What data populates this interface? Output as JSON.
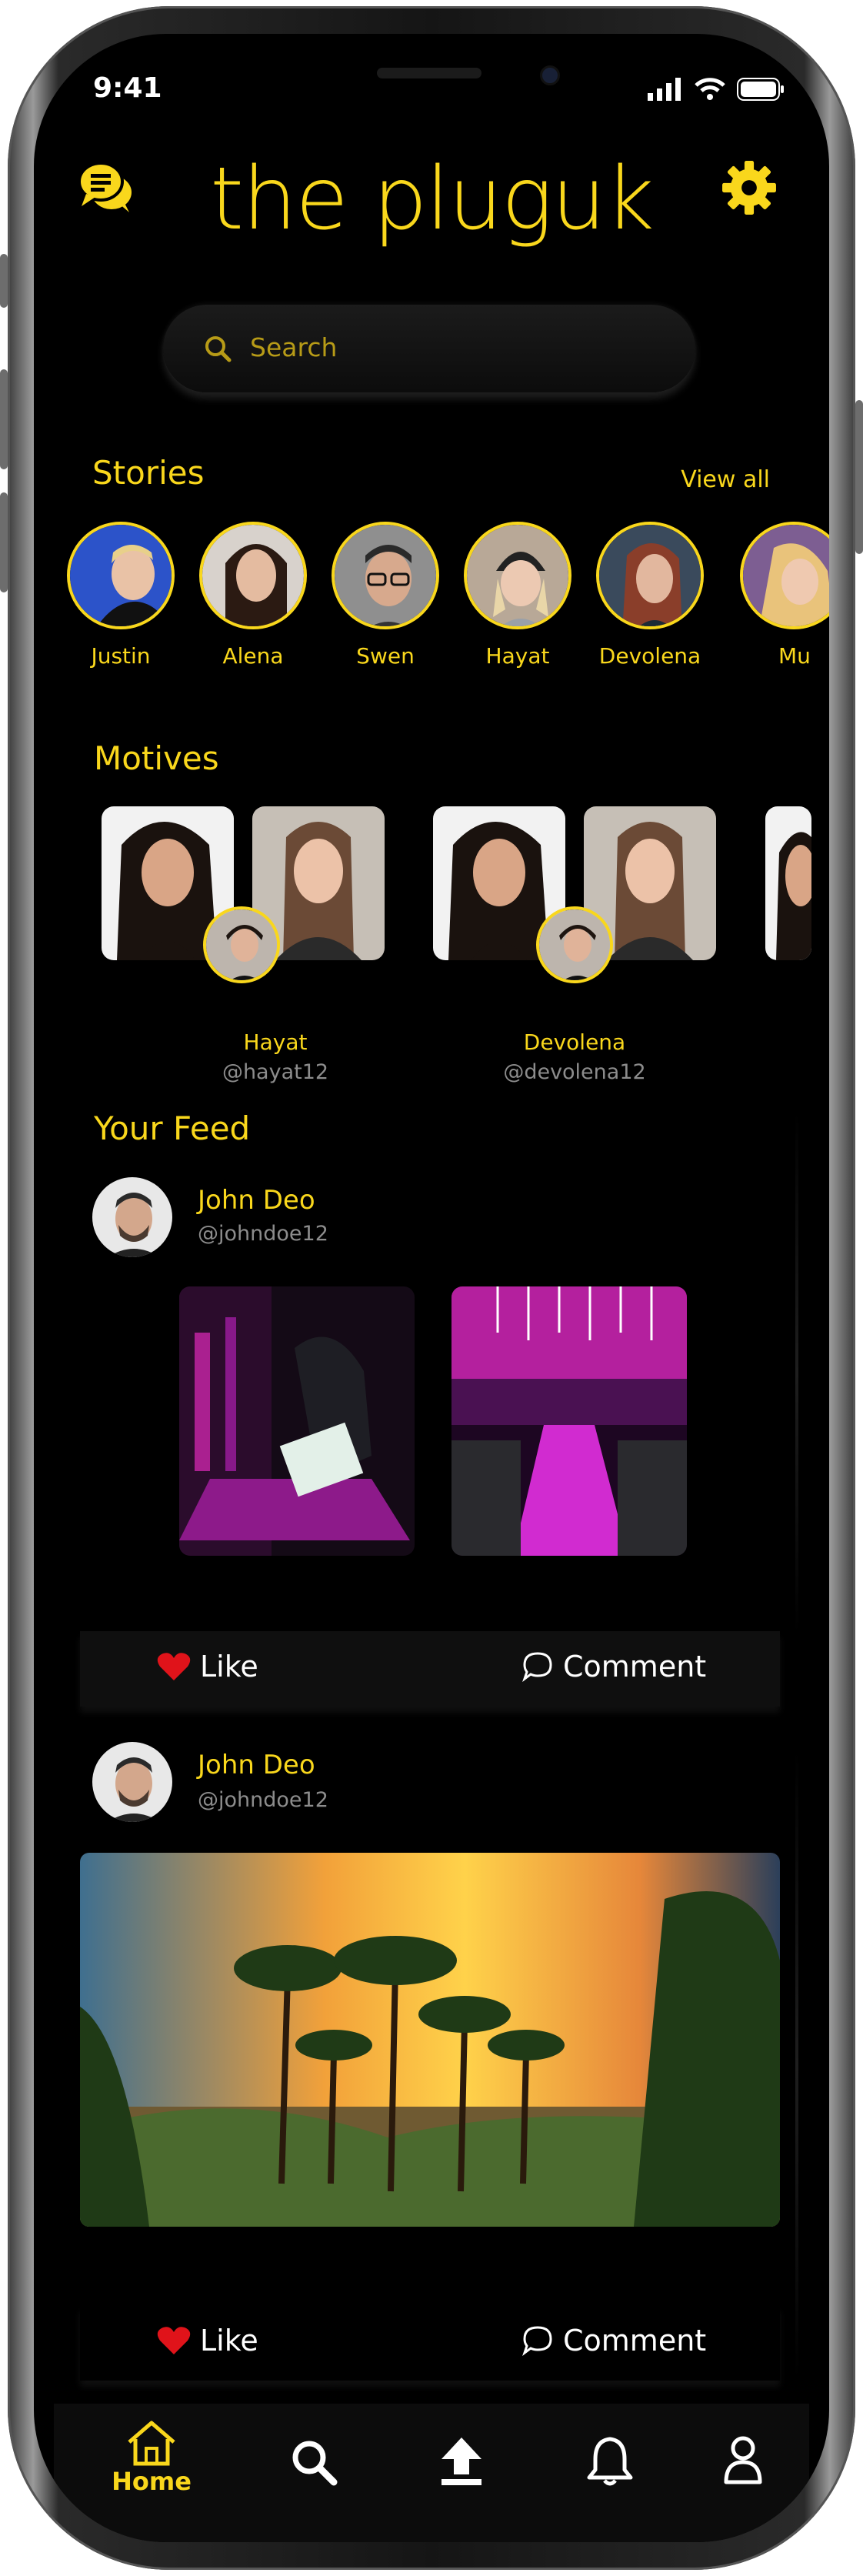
{
  "status_bar": {
    "time": "9:41"
  },
  "header": {
    "logo": "the pluguk",
    "chat_icon": "chat-bubbles-icon",
    "settings_icon": "gear-icon"
  },
  "search": {
    "placeholder": "Search"
  },
  "stories": {
    "title": "Stories",
    "view_all": "View all",
    "items": [
      {
        "name": "Justin",
        "color": "#2c53c9"
      },
      {
        "name": "Alena",
        "color": "#c9c3bd"
      },
      {
        "name": "Swen",
        "color": "#8f8f8f"
      },
      {
        "name": "Hayat",
        "color": "#b8a897"
      },
      {
        "name": "Devolena",
        "color": "#3a4a5c"
      },
      {
        "name": "Mu",
        "color": "#7d5e92"
      }
    ]
  },
  "motives": {
    "title": "Motives",
    "items": [
      {
        "name": "Hayat",
        "handle": "@hayat12"
      },
      {
        "name": "Devolena",
        "handle": "@devolena12"
      }
    ]
  },
  "feed": {
    "title": "Your Feed",
    "posts": [
      {
        "user": "John Deo",
        "handle": "@johndoe12",
        "like": "Like",
        "comment": "Comment"
      },
      {
        "user": "John Deo",
        "handle": "@johndoe12",
        "like": "Like",
        "comment": "Comment"
      }
    ]
  },
  "nav": {
    "home": "Home",
    "items": [
      "home-icon",
      "search-icon",
      "upload-icon",
      "bell-icon",
      "profile-icon"
    ]
  },
  "colors": {
    "accent": "#f9d71c",
    "background": "#000000",
    "like": "#e0131a"
  }
}
